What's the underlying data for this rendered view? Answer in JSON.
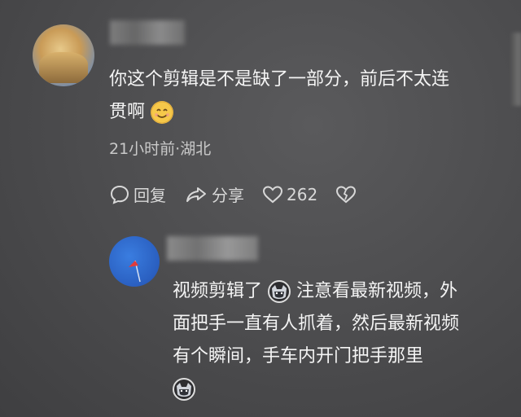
{
  "comment1": {
    "line1": "你这个剪辑是不是缺了一部分，前后不太连",
    "line2": "贯啊",
    "meta": "21小时前·湖北",
    "reply_label": "回复",
    "share_label": "分享",
    "like_count": "262"
  },
  "reply1": {
    "line1_start": "视频剪辑了",
    "line1_end": "注意看最新视频，外",
    "line2": "面把手一直有人抓着，然后最新视频",
    "line3": "有个瞬间，手车内开门把手那里"
  },
  "icons": {
    "reply": "comment-bubble-icon",
    "share": "share-arrow-icon",
    "like": "heart-icon",
    "dislike": "broken-heart-icon",
    "smile_emoji": "smiling-face-emoji",
    "cat_emoji": "cat-emoji"
  }
}
